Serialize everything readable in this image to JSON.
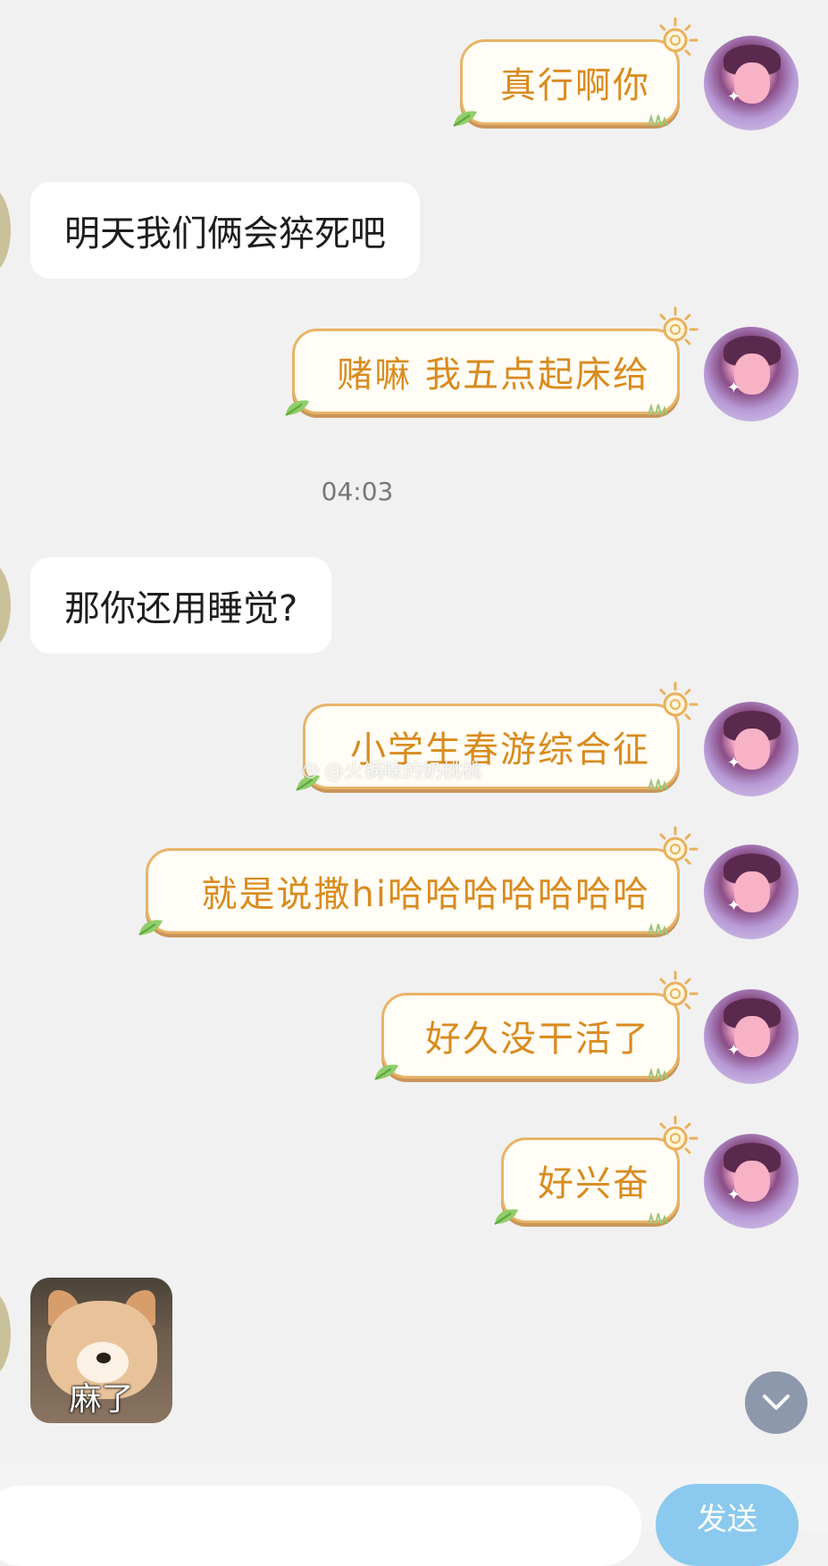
{
  "messages": [
    {
      "side": "own",
      "text": "真行啊你"
    },
    {
      "side": "partner",
      "text": "明天我们俩会猝死吧"
    },
    {
      "side": "own",
      "text": "赌嘛 我五点起床给"
    },
    {
      "side": "partner",
      "text": "那你还用睡觉?"
    },
    {
      "side": "own",
      "text": "小学生春游综合征"
    },
    {
      "side": "own",
      "text": "就是说撒hi哈哈哈哈哈哈哈"
    },
    {
      "side": "own",
      "text": "好久没干活了"
    },
    {
      "side": "own",
      "text": "好兴奋"
    }
  ],
  "timestamp": "04:03",
  "sticker": {
    "caption": "麻了"
  },
  "watermark": "@火锅味的奶桃桃",
  "input": {
    "send_label": "发送"
  },
  "icons": {
    "scroll": "chevron-down-icon",
    "bubble_sun": "sun-icon",
    "bubble_leaf": "leaf-icon"
  },
  "colors": {
    "own_text": "#d98b1e",
    "own_border": "#e8b467",
    "send": "#8cc9ee",
    "background": "#f1f1f1"
  }
}
